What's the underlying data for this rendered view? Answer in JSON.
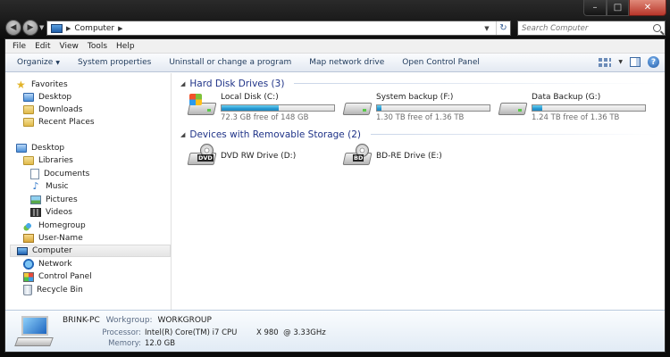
{
  "window": {
    "address_path": "Computer",
    "search_placeholder": "Search Computer"
  },
  "menu": {
    "file": "File",
    "edit": "Edit",
    "view": "View",
    "tools": "Tools",
    "help": "Help"
  },
  "toolbar": {
    "organize": "Organize",
    "system_properties": "System properties",
    "uninstall": "Uninstall or change a program",
    "map_drive": "Map network drive",
    "open_cp": "Open Control Panel"
  },
  "nav": {
    "favorites": "Favorites",
    "desktop_fav": "Desktop",
    "downloads": "Downloads",
    "recent_places": "Recent Places",
    "desktop": "Desktop",
    "libraries": "Libraries",
    "documents": "Documents",
    "music": "Music",
    "pictures": "Pictures",
    "videos": "Videos",
    "homegroup": "Homegroup",
    "user_name": "User-Name",
    "computer": "Computer",
    "network": "Network",
    "control_panel": "Control Panel",
    "recycle_bin": "Recycle Bin"
  },
  "groups": {
    "hdd": "Hard Disk Drives (3)",
    "removable": "Devices with Removable Storage (2)"
  },
  "drives": {
    "c": {
      "name": "Local Disk (C:)",
      "free": "72.3 GB free of 148 GB",
      "used_fraction": 0.51
    },
    "f": {
      "name": "System backup (F:)",
      "free": "1.30 TB free of 1.36 TB",
      "used_fraction": 0.04
    },
    "g": {
      "name": "Data Backup (G:)",
      "free": "1.24 TB free of 1.36 TB",
      "used_fraction": 0.09
    },
    "d": {
      "name": "DVD RW Drive (D:)",
      "badge": "DVD"
    },
    "e": {
      "name": "BD-RE Drive (E:)",
      "badge": "BD"
    }
  },
  "details": {
    "pc_name": "BRINK-PC",
    "workgroup_label": "Workgroup:",
    "workgroup": "WORKGROUP",
    "processor_label": "Processor:",
    "processor": "Intel(R) Core(TM) i7 CPU        X 980  @ 3.33GHz",
    "memory_label": "Memory:",
    "memory": "12.0 GB"
  }
}
